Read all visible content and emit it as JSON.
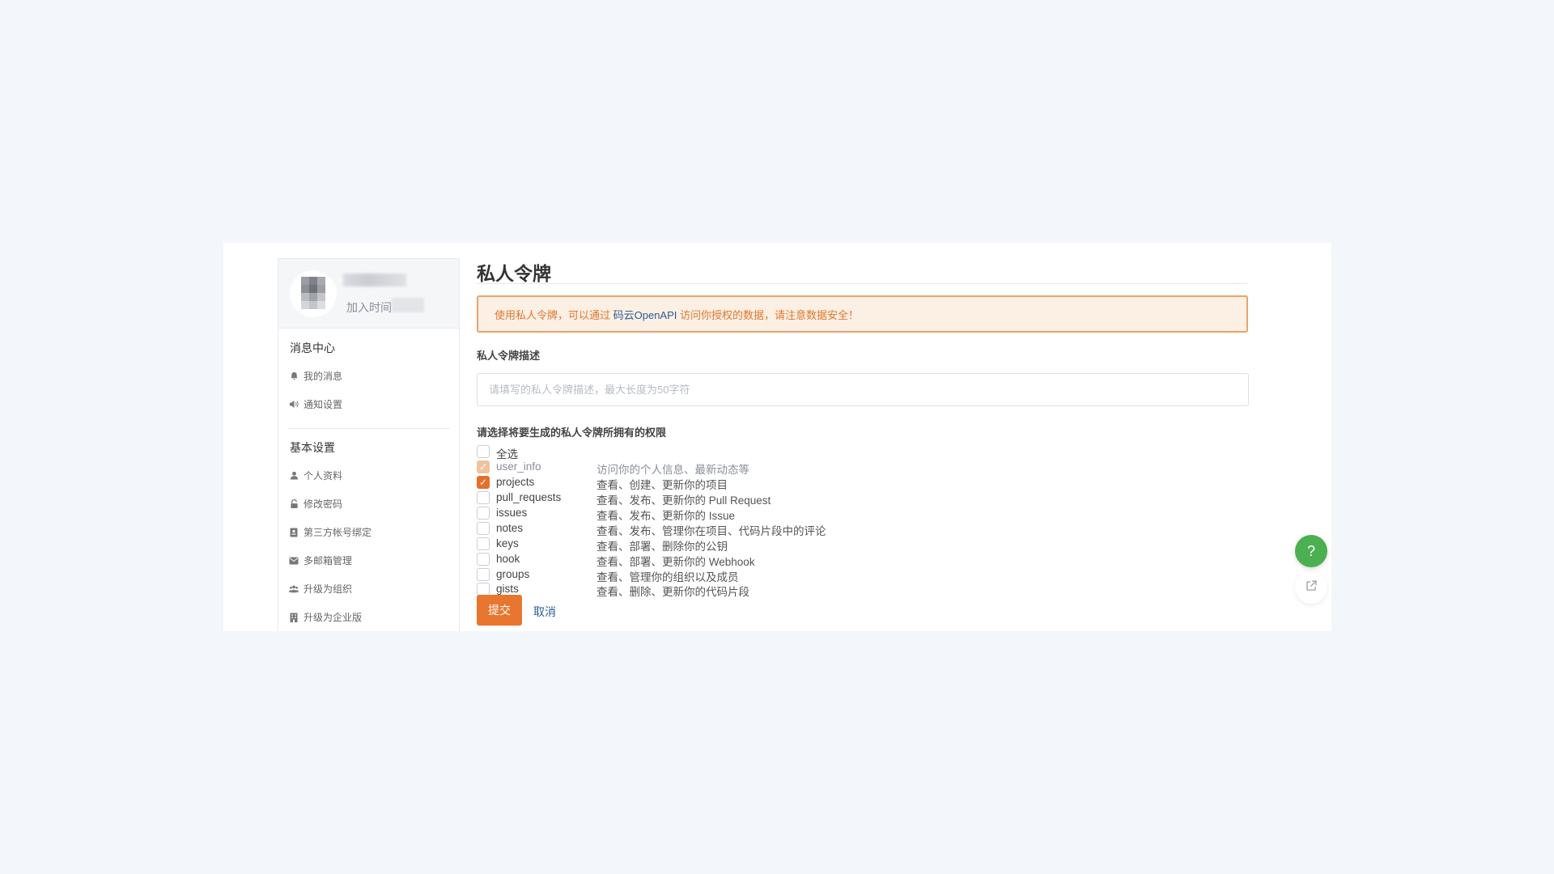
{
  "profile": {
    "join_label": "加入时间"
  },
  "sidebar": {
    "groups": [
      {
        "title": "消息中心",
        "items": [
          {
            "icon": "bell-icon",
            "label": "我的消息"
          },
          {
            "icon": "volume-icon",
            "label": "通知设置"
          }
        ]
      },
      {
        "title": "基本设置",
        "items": [
          {
            "icon": "user-icon",
            "label": "个人资料"
          },
          {
            "icon": "unlock-icon",
            "label": "修改密码"
          },
          {
            "icon": "id-card-icon",
            "label": "第三方帐号绑定"
          },
          {
            "icon": "envelope-icon",
            "label": "多邮箱管理"
          },
          {
            "icon": "users-icon",
            "label": "升级为组织"
          },
          {
            "icon": "building-icon",
            "label": "升级为企业版"
          }
        ]
      }
    ]
  },
  "main": {
    "title": "私人令牌",
    "alert": {
      "prefix": "使用私人令牌，可以通过 ",
      "link": "码云OpenAPI",
      "suffix": " 访问你授权的数据，请注意数据安全！"
    },
    "desc_label": "私人令牌描述",
    "desc_placeholder": "请填写的私人令牌描述，最大长度为50字符",
    "perm_label": "请选择将要生成的私人令牌所拥有的权限",
    "select_all": "全选",
    "permissions": [
      {
        "name": "user_info",
        "desc": "访问你的个人信息、最新动态等",
        "checked": true,
        "disabled": true
      },
      {
        "name": "projects",
        "desc": "查看、创建、更新你的项目",
        "checked": true,
        "disabled": false
      },
      {
        "name": "pull_requests",
        "desc": "查看、发布、更新你的 Pull Request",
        "checked": false,
        "disabled": false
      },
      {
        "name": "issues",
        "desc": "查看、发布、更新你的 Issue",
        "checked": false,
        "disabled": false
      },
      {
        "name": "notes",
        "desc": "查看、发布、管理你在项目、代码片段中的评论",
        "checked": false,
        "disabled": false
      },
      {
        "name": "keys",
        "desc": "查看、部署、删除你的公钥",
        "checked": false,
        "disabled": false
      },
      {
        "name": "hook",
        "desc": "查看、部署、更新你的 Webhook",
        "checked": false,
        "disabled": false
      },
      {
        "name": "groups",
        "desc": "查看、管理你的组织以及成员",
        "checked": false,
        "disabled": false
      },
      {
        "name": "gists",
        "desc": "查看、删除、更新你的代码片段",
        "checked": false,
        "disabled": false
      }
    ],
    "submit_label": "提交",
    "cancel_label": "取消"
  },
  "floating": {
    "help_symbol": "?",
    "help_color": "#4caf50"
  },
  "colors": {
    "accent": "#e8762e",
    "link": "#2a5c95",
    "alert_bg": "#fcefe3",
    "alert_border": "#e9a36e"
  }
}
